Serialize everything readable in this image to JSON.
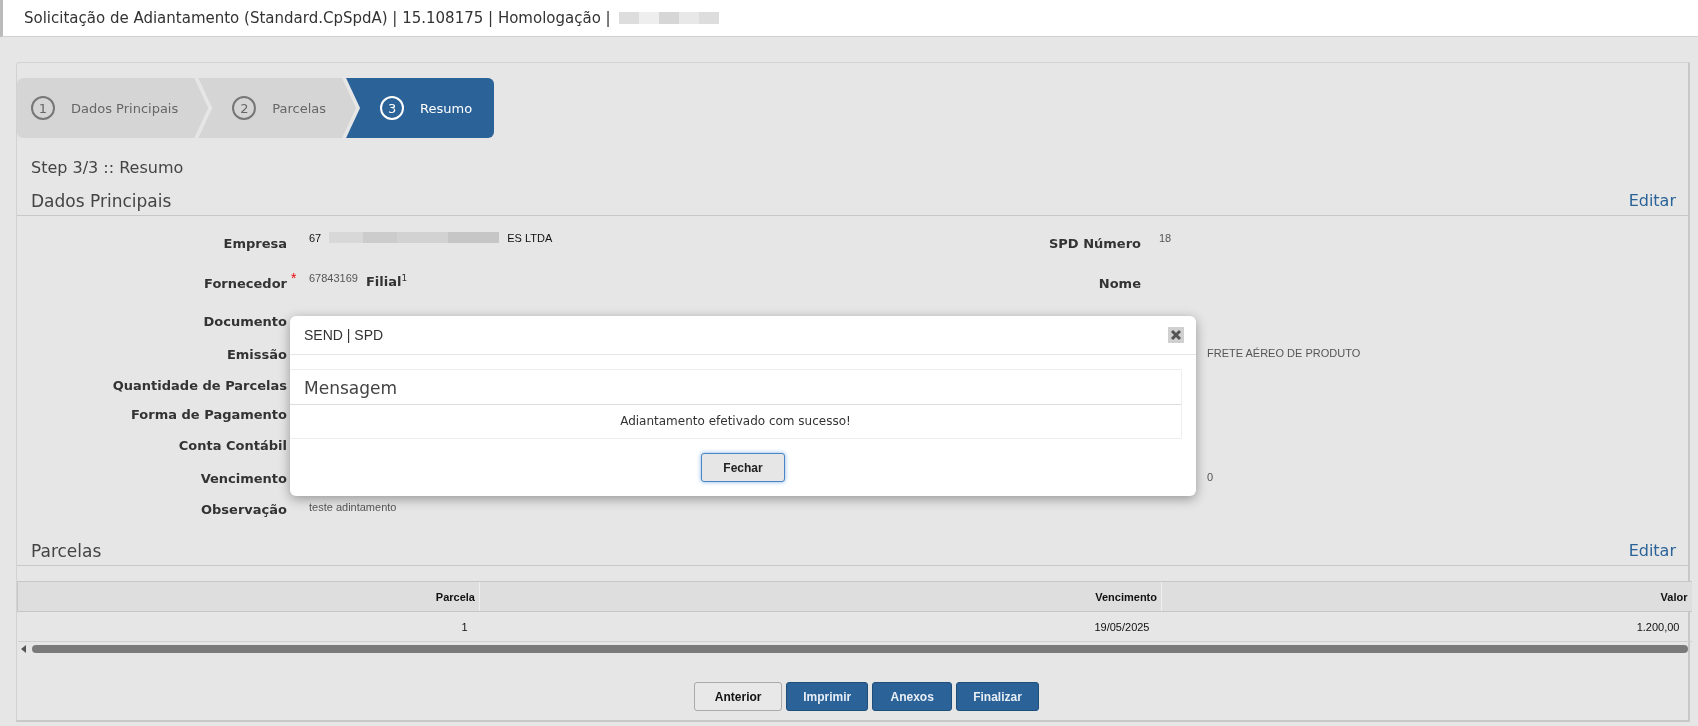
{
  "window": {
    "title": "Solicitação de Adiantamento (Standard.CpSpdA) | 15.108175 | Homologação |",
    "title_redacted": true
  },
  "wizard": {
    "steps": [
      {
        "number": "1",
        "label": "Dados Principais",
        "selected": false
      },
      {
        "number": "2",
        "label": "Parcelas",
        "selected": false
      },
      {
        "number": "3",
        "label": "Resumo",
        "selected": true
      }
    ]
  },
  "step_title": "Step 3/3 :: Resumo",
  "dados_principais": {
    "title": "Dados Principais",
    "edit_link": "Editar",
    "rows": [
      {
        "left": {
          "label": "Empresa",
          "parts": [
            {
              "kind": "text",
              "text": "67"
            },
            {
              "kind": "redacted"
            },
            {
              "kind": "text",
              "text": "ES LTDA"
            }
          ]
        },
        "right": {
          "label": "SPD Número",
          "value": "18"
        }
      },
      {
        "left": {
          "label": "Fornecedor",
          "required_mark": "*",
          "value": "67843169",
          "extra_label": "Filial$^{1}$"
        },
        "right": {
          "label": "Nome"
        }
      },
      {
        "left": {
          "label": "Documento"
        }
      },
      {
        "left": {
          "label": "Emissão"
        },
        "right": {
          "value": "FRETE AÉREO DE PRODUTO"
        }
      },
      {
        "left": {
          "label": "Quantidade de Parcelas"
        }
      },
      {
        "left": {
          "label": "Forma de Pagamento"
        }
      },
      {
        "left": {
          "label": "Conta Contábil"
        }
      },
      {
        "left": {
          "label": "Vencimento"
        },
        "right": {
          "value": "0"
        }
      },
      {
        "left": {
          "label": "Observação",
          "value": "teste adintamento"
        }
      }
    ]
  },
  "parcelas": {
    "title": "Parcelas",
    "edit_link": "Editar",
    "table": {
      "columns": [
        "Parcela",
        "Vencimento",
        "Valor"
      ],
      "rows": [
        [
          "1",
          "19/05/2025",
          "1.200,00"
        ]
      ]
    }
  },
  "buttons": [
    {
      "label": "Anterior",
      "kind": "secondary"
    },
    {
      "label": "Imprimir",
      "kind": "primary"
    },
    {
      "label": "Anexos",
      "kind": "primary"
    },
    {
      "label": "Finalizar",
      "kind": "primary"
    }
  ],
  "dialog": {
    "title": "SEND | SPD",
    "heading": "Mensagem",
    "message": "Adiantamento efetivado com sucesso!",
    "button": "Fechar"
  }
}
